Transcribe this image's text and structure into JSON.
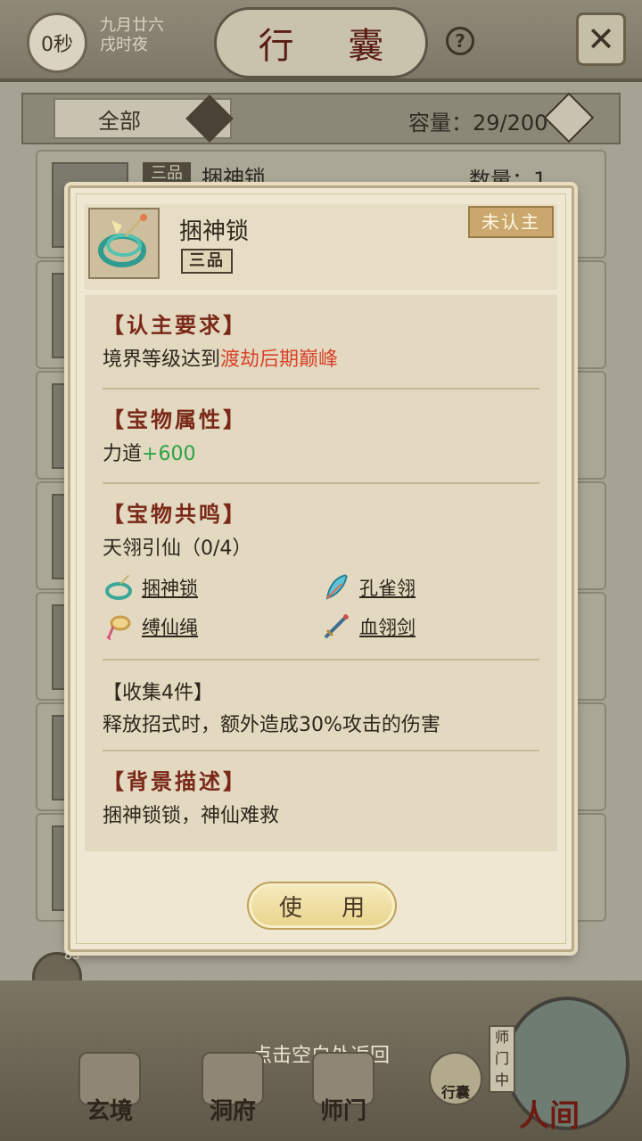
{
  "top_bar": {
    "timer": "0秒",
    "date_line1": "九月廿六",
    "date_line2": "戌时夜",
    "title": "行 囊",
    "help": "?"
  },
  "filter": {
    "selected": "全部",
    "capacity": "容量：29/200"
  },
  "bag_list": [
    {
      "rank": "三品",
      "name": "捆神锁",
      "qty": "数量：1"
    },
    {
      "rank": "",
      "name": "",
      "qty": ""
    },
    {
      "rank": "",
      "name": "",
      "qty": ""
    },
    {
      "rank": "",
      "name": "",
      "qty": ""
    },
    {
      "rank": "",
      "name": "",
      "qty": ""
    },
    {
      "rank": "",
      "name": "",
      "qty": ""
    },
    {
      "rank": "",
      "name": "",
      "qty": ""
    }
  ],
  "dialog": {
    "item_name": "捆神锁",
    "item_rank": "三品",
    "bind_status": "未认主",
    "req_title": "【认主要求】",
    "req_prefix": "境界等级达到",
    "req_value": "渡劫后期巅峰",
    "attr_title": "【宝物属性】",
    "attr_name": "力道",
    "attr_value": "+600",
    "set_title": "【宝物共鸣】",
    "set_name": "天翎引仙（0/4）",
    "set_items": [
      "捆神锁",
      "孔雀翎",
      "缚仙绳",
      "血翎剑"
    ],
    "bonus_title": "【收集4件】",
    "bonus_text": "释放招式时，额外造成30%攻击的伤害",
    "bg_title": "【背景描述】",
    "bg_text": "捆神锁锁，神仙难救",
    "use_button": "使 用"
  },
  "chat": {
    "badge": "83"
  },
  "bottom_nav": {
    "return_hint": "点击空白处返回",
    "items": [
      "玄境",
      "洞府",
      "师门",
      "行囊"
    ],
    "sect_tag": "师门中",
    "world": "人间"
  },
  "colors": {
    "highlight_red": "#d8442c",
    "stat_green": "#2fa345",
    "section_title": "#7a2818"
  }
}
